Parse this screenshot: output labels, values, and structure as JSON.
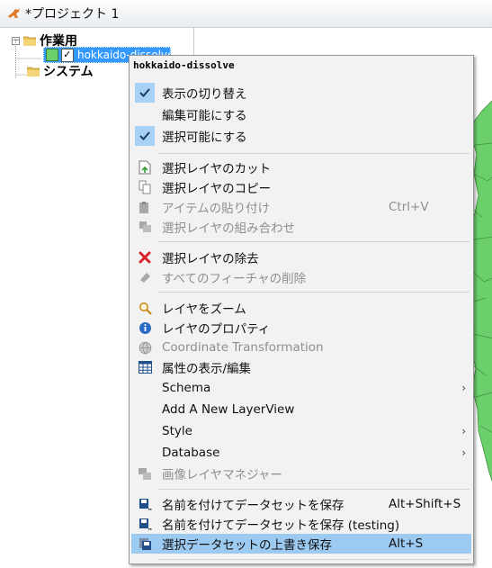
{
  "window": {
    "title": "*プロジェクト 1"
  },
  "tree": {
    "group_label": "作業用",
    "group_expander": "−",
    "layer_name": "hokkaido-dissolve",
    "system_label": "システム",
    "system_expander": "+"
  },
  "menu": {
    "header": "hokkaido-dissolve",
    "items": [
      {
        "label": "表示の切り替え",
        "shortcut": "",
        "icon": "check-icon",
        "checked": true
      },
      {
        "label": "編集可能にする",
        "shortcut": "",
        "icon": "",
        "checked": false
      },
      {
        "label": "選択可能にする",
        "shortcut": "",
        "icon": "check-icon",
        "checked": true
      },
      {
        "label": "選択レイヤのカット",
        "shortcut": "",
        "icon": "cut-page-icon"
      },
      {
        "label": "選択レイヤのコピー",
        "shortcut": "",
        "icon": "copy-icon"
      },
      {
        "label": "アイテムの貼り付け",
        "shortcut": "Ctrl+V",
        "icon": "paste-icon",
        "disabled": true
      },
      {
        "label": "選択レイヤの組み合わせ",
        "shortcut": "",
        "icon": "combine-icon",
        "disabled": true
      },
      {
        "label": "選択レイヤの除去",
        "shortcut": "",
        "icon": "remove-icon"
      },
      {
        "label": "すべてのフィーチャの削除",
        "shortcut": "",
        "icon": "eraser-icon",
        "disabled": true
      },
      {
        "label": "レイヤをズーム",
        "shortcut": "",
        "icon": "zoom-icon"
      },
      {
        "label": "レイヤのプロパティ",
        "shortcut": "",
        "icon": "info-icon"
      },
      {
        "label": "Coordinate Transformation",
        "shortcut": "",
        "icon": "globe-icon",
        "disabled": true
      },
      {
        "label": "属性の表示/編集",
        "shortcut": "",
        "icon": "table-icon"
      },
      {
        "label": "Schema",
        "shortcut": "",
        "icon": "",
        "submenu": true
      },
      {
        "label": "Add A New LayerView",
        "shortcut": "",
        "icon": ""
      },
      {
        "label": "Style",
        "shortcut": "",
        "icon": "",
        "submenu": true
      },
      {
        "label": "Database",
        "shortcut": "",
        "icon": "",
        "submenu": true
      },
      {
        "label": "画像レイヤマネジャー",
        "shortcut": "",
        "icon": "image-layer-icon",
        "disabled": true
      },
      {
        "label": "名前を付けてデータセットを保存",
        "shortcut": "Alt+Shift+S",
        "icon": "save-as-icon"
      },
      {
        "label": "名前を付けてデータセットを保存 (testing)",
        "shortcut": "",
        "icon": "save-as-icon"
      },
      {
        "label": "選択データセットの上書き保存",
        "shortcut": "Alt+S",
        "icon": "save-icon",
        "highlighted": true
      }
    ],
    "submenu_arrow": "›"
  },
  "colors": {
    "map_fill": "#6bd06b",
    "map_stroke": "#3f8f3f",
    "highlight": "#9ccaf1",
    "selection": "#3399ff"
  }
}
